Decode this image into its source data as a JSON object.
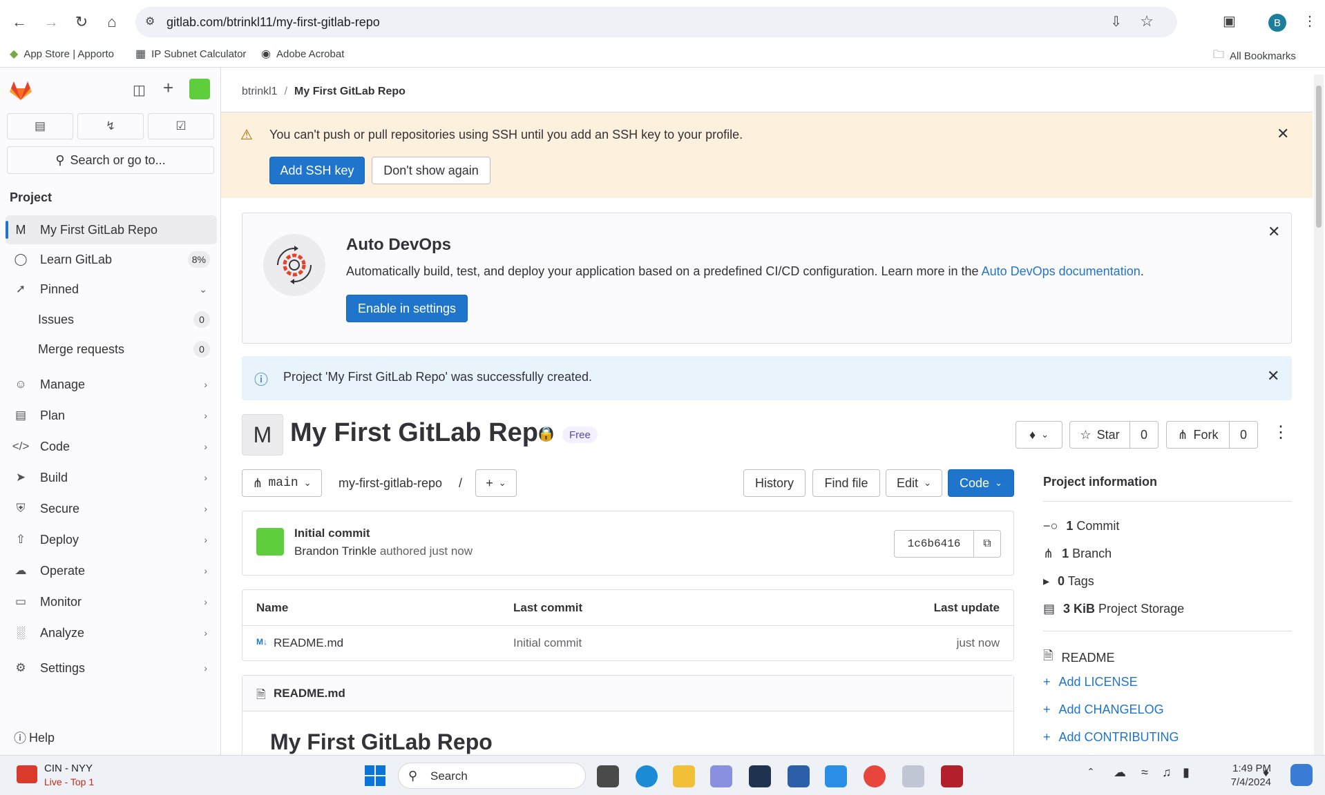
{
  "browser": {
    "url": "gitlab.com/btrinkl11/my-first-gitlab-repo",
    "profile_initial": "B",
    "bookmarks": [
      "App Store | Apporto",
      "IP Subnet Calculator",
      "Adobe Acrobat"
    ],
    "all_bookmarks": "All Bookmarks"
  },
  "sidebar": {
    "search_placeholder": "Search or go to...",
    "section": "Project",
    "project_avatar": "M",
    "project_name": "My First GitLab Repo",
    "learn": {
      "label": "Learn GitLab",
      "badge": "8%"
    },
    "pinned": "Pinned",
    "pinned_items": [
      {
        "label": "Issues",
        "count": "0"
      },
      {
        "label": "Merge requests",
        "count": "0"
      }
    ],
    "nav": [
      "Manage",
      "Plan",
      "Code",
      "Build",
      "Secure",
      "Deploy",
      "Operate",
      "Monitor",
      "Analyze",
      "Settings"
    ],
    "help": "Help"
  },
  "breadcrumb": {
    "owner": "btrinkl1",
    "sep": "/",
    "project": "My First GitLab Repo"
  },
  "ssh_alert": {
    "text": "You can't push or pull repositories using SSH until you add an SSH key to your profile.",
    "primary": "Add SSH key",
    "secondary": "Don't show again"
  },
  "devops": {
    "title": "Auto DevOps",
    "text": "Automatically build, test, and deploy your application based on a predefined CI/CD configuration. Learn more in the",
    "link": "Auto DevOps documentation",
    "link_end": ".",
    "button": "Enable in settings"
  },
  "created_alert": "Project 'My First GitLab Repo' was successfully created.",
  "project": {
    "avatar": "M",
    "title": "My First GitLab Repo",
    "tier": "Free",
    "star": "Star",
    "star_count": "0",
    "fork": "Fork",
    "fork_count": "0"
  },
  "repo_bar": {
    "branch": "main",
    "path": "my-first-gitlab-repo",
    "path_sep": "/",
    "history": "History",
    "find_file": "Find file",
    "edit": "Edit",
    "code": "Code"
  },
  "commit": {
    "title": "Initial commit",
    "author": "Brandon Trinkle",
    "meta": "authored just now",
    "sha": "1c6b6416"
  },
  "files": {
    "headers": [
      "Name",
      "Last commit",
      "Last update"
    ],
    "rows": [
      {
        "name": "README.md",
        "commit": "Initial commit",
        "updated": "just now"
      }
    ]
  },
  "readme": {
    "filename": "README.md",
    "heading": "My First GitLab Repo"
  },
  "project_info": {
    "title": "Project information",
    "stats": [
      {
        "value": "1",
        "label": "Commit"
      },
      {
        "value": "1",
        "label": "Branch"
      },
      {
        "value": "0",
        "label": "Tags"
      },
      {
        "value": "3 KiB",
        "label": "Project Storage"
      }
    ],
    "readme": "README",
    "add_links": [
      "Add LICENSE",
      "Add CHANGELOG",
      "Add CONTRIBUTING"
    ]
  },
  "taskbar": {
    "weather_title": "CIN - NYY",
    "weather_sub": "Live - Top 1",
    "search": "Search",
    "time": "1:49 PM",
    "date": "7/4/2024"
  }
}
